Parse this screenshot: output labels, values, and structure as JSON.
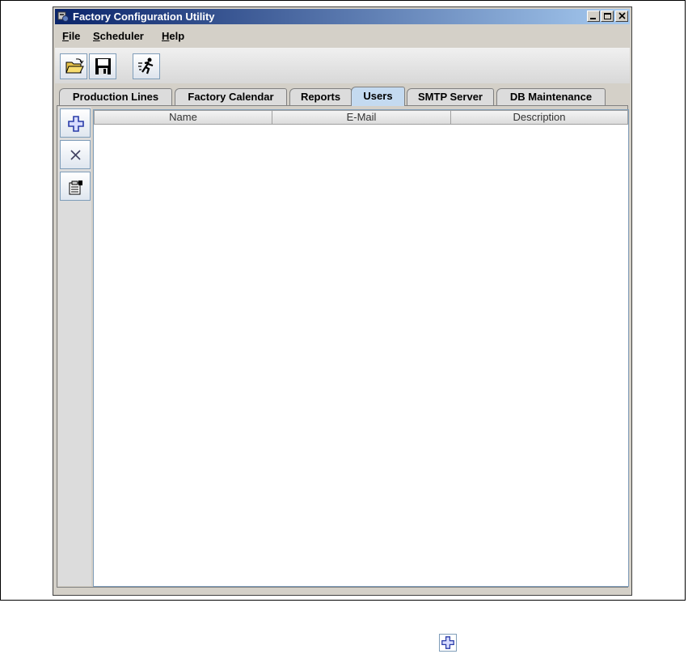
{
  "window": {
    "title": "Factory Configuration Utility",
    "controls": [
      "minimize",
      "maximize",
      "close"
    ]
  },
  "menubar": {
    "items": [
      {
        "label": "File"
      },
      {
        "label": "Scheduler"
      },
      {
        "label": "Help"
      }
    ]
  },
  "toolbar": {
    "buttons": [
      {
        "icon": "open-folder-icon"
      },
      {
        "icon": "save-disk-icon"
      },
      {
        "icon": "run-icon"
      }
    ]
  },
  "tabs": [
    {
      "label": "Production Lines",
      "active": false
    },
    {
      "label": "Factory Calendar",
      "active": false
    },
    {
      "label": "Reports",
      "active": false
    },
    {
      "label": "Users",
      "active": true
    },
    {
      "label": "SMTP Server",
      "active": false
    },
    {
      "label": "DB Maintenance",
      "active": false
    }
  ],
  "users_panel": {
    "side_buttons": [
      {
        "icon": "add-plus-icon"
      },
      {
        "icon": "delete-x-icon"
      },
      {
        "icon": "properties-icon"
      }
    ],
    "table": {
      "columns": [
        "Name",
        "E-Mail",
        "Description"
      ],
      "rows": []
    }
  },
  "colors": {
    "titlebar_start": "#0a246a",
    "titlebar_end": "#a6caf0",
    "active_tab": "#c4daf0",
    "button_border": "#7f9db9"
  }
}
